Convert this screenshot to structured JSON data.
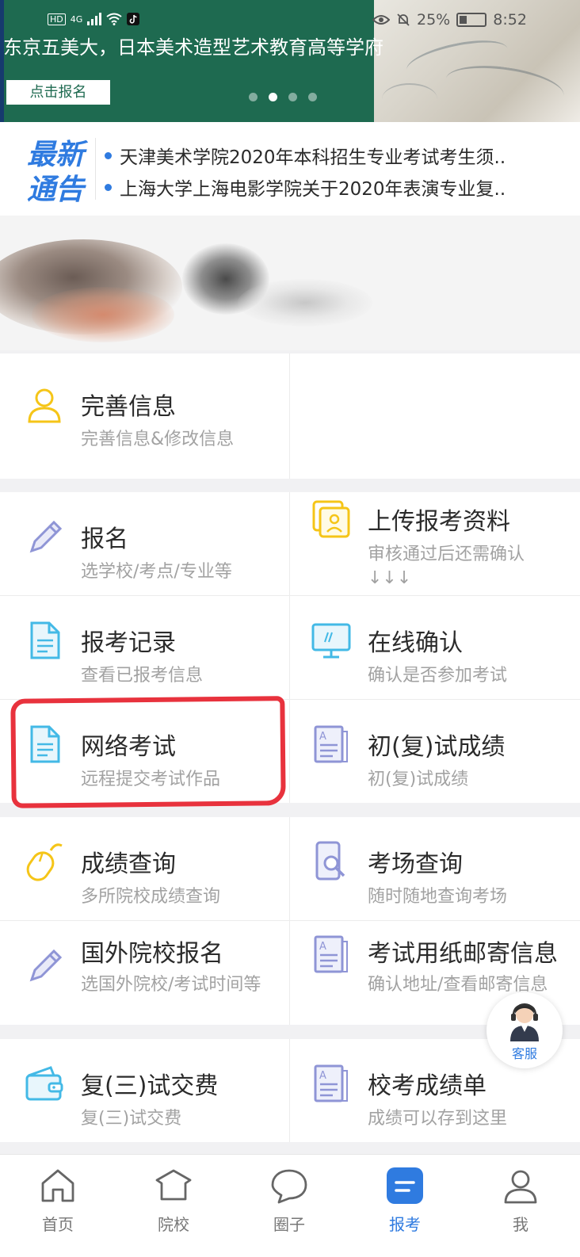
{
  "banner": {
    "caption": "东京五美大，日本美术造型艺术教育高等学府",
    "button_label": "点击报名",
    "page_count": 4,
    "active_page": 2
  },
  "status_bar": {
    "battery": "25%",
    "time": "8:52",
    "network": "4G",
    "hd": "HD"
  },
  "notice": {
    "logo_line1": "最新",
    "logo_line2": "通告",
    "items": [
      "天津美术学院2020年本科招生专业考试考生须..",
      "上海大学上海电影学院关于2020年表演专业复.."
    ]
  },
  "grid": {
    "perfect_info": {
      "title": "完善信息",
      "subtitle": "完善信息&修改信息",
      "icon": "user-outline-icon"
    },
    "enroll": {
      "title": "报名",
      "subtitle": "选学校/考点/专业等",
      "icon": "pencil-icon"
    },
    "upload": {
      "title": "上传报考资料",
      "subtitle": "审核通过后还需确认↓↓↓",
      "icon": "id-card-icon"
    },
    "record": {
      "title": "报考记录",
      "subtitle": "查看已报考信息",
      "icon": "document-icon"
    },
    "confirm": {
      "title": "在线确认",
      "subtitle": "确认是否参加考试",
      "icon": "monitor-icon"
    },
    "online_exam": {
      "title": "网络考试",
      "subtitle": "远程提交考试作品",
      "icon": "document-icon"
    },
    "prelim_score": {
      "title": "初(复)试成绩",
      "subtitle": "初(复)试成绩",
      "icon": "report-icon"
    },
    "score_query": {
      "title": "成绩查询",
      "subtitle": "多所院校成绩查询",
      "icon": "mouse-icon"
    },
    "venue_query": {
      "title": "考场查询",
      "subtitle": "随时随地查询考场",
      "icon": "phone-search-icon"
    },
    "foreign_enroll": {
      "title": "国外院校报名",
      "subtitle": "选国外院校/考试时间等",
      "icon": "pencil-icon"
    },
    "paper_mail": {
      "title": "考试用纸邮寄信息",
      "subtitle": "确认地址/查看邮寄信息",
      "icon": "report-icon"
    },
    "fee": {
      "title": "复(三)试交费",
      "subtitle": "复(三)试交费",
      "icon": "wallet-icon"
    },
    "transcript": {
      "title": "校考成绩单",
      "subtitle": "成绩可以存到这里",
      "icon": "report-icon"
    }
  },
  "service": {
    "label": "客服",
    "icon": "customer-service-icon"
  },
  "tabbar": {
    "active": "报考",
    "tabs": [
      {
        "label": "首页",
        "icon": "home-icon"
      },
      {
        "label": "院校",
        "icon": "school-icon"
      },
      {
        "label": "圈子",
        "icon": "chat-bubble-icon"
      },
      {
        "label": "报考",
        "icon": "enroll-icon"
      },
      {
        "label": "我",
        "icon": "profile-icon"
      }
    ]
  },
  "colors": {
    "accent": "#2f7be0",
    "highlight": "#e8323d",
    "yellow_icon": "#f5c518",
    "lavender_icon": "#8f95d6",
    "cyan_icon": "#43b9e6"
  }
}
